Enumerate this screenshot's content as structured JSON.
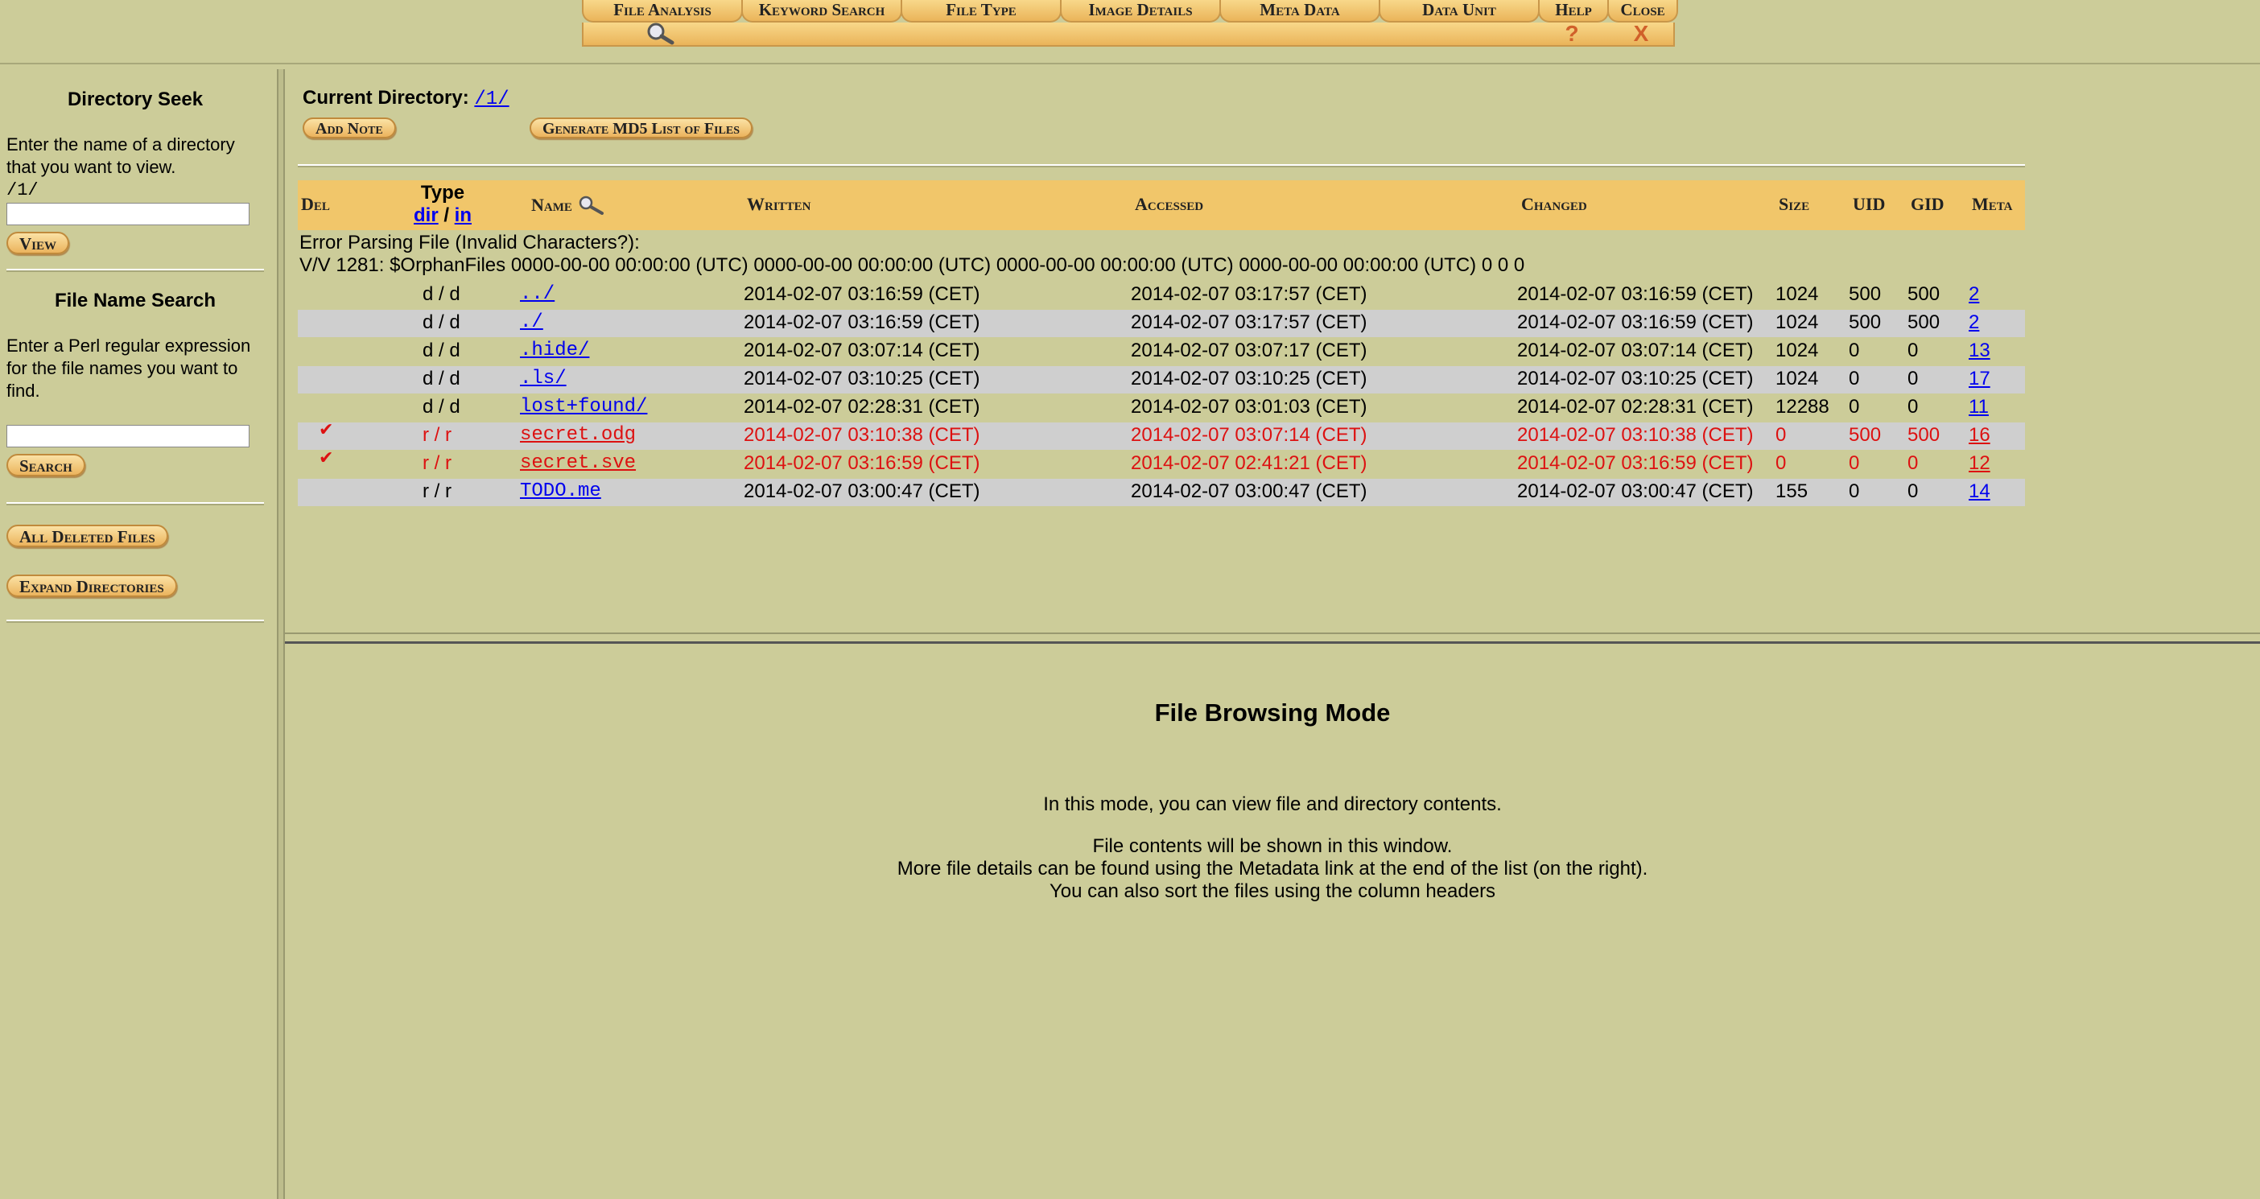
{
  "toolbar": {
    "tabs": [
      "File Analysis",
      "Keyword Search",
      "File Type",
      "Image Details",
      "Meta Data",
      "Data Unit",
      "Help",
      "Close"
    ],
    "help_glyph": "?",
    "close_glyph": "X"
  },
  "sidebar": {
    "dir_seek_title": "Directory Seek",
    "dir_seek_text": "Enter the name of a directory that you want to view.",
    "dir_seek_current": "/1/",
    "dir_input_value": "",
    "view_button": "View",
    "name_search_title": "File Name Search",
    "name_search_text": "Enter a Perl regular expression for the file names you want to find.",
    "name_input_value": "",
    "search_button": "Search",
    "all_deleted_button": "All Deleted Files",
    "expand_dirs_button": "Expand Directories"
  },
  "main": {
    "current_dir_label": "Current Directory:",
    "current_dir_path": "/1/",
    "add_note_button": "Add Note",
    "md5_button": "Generate MD5 List of Files",
    "columns": {
      "del": "Del",
      "type": "Type",
      "type_dir": "dir",
      "type_sep": "/",
      "type_in": "in",
      "name": "Name",
      "written": "Written",
      "accessed": "Accessed",
      "changed": "Changed",
      "size": "Size",
      "uid": "UID",
      "gid": "GID",
      "meta": "Meta"
    },
    "error_line1": "Error Parsing File (Invalid Characters?):",
    "error_line2": "V/V 1281: $OrphanFiles 0000-00-00 00:00:00 (UTC) 0000-00-00 00:00:00 (UTC) 0000-00-00 00:00:00 (UTC) 0000-00-00 00:00:00 (UTC) 0 0 0",
    "rows": [
      {
        "del": "",
        "type": "d / d",
        "name": "../",
        "written": "2014-02-07 03:16:59 (CET)",
        "accessed": "2014-02-07 03:17:57 (CET)",
        "changed": "2014-02-07 03:16:59 (CET)",
        "size": "1024",
        "uid": "500",
        "gid": "500",
        "meta": "2"
      },
      {
        "del": "",
        "type": "d / d",
        "name": "./",
        "written": "2014-02-07 03:16:59 (CET)",
        "accessed": "2014-02-07 03:17:57 (CET)",
        "changed": "2014-02-07 03:16:59 (CET)",
        "size": "1024",
        "uid": "500",
        "gid": "500",
        "meta": "2"
      },
      {
        "del": "",
        "type": "d / d",
        "name": ".hide/",
        "written": "2014-02-07 03:07:14 (CET)",
        "accessed": "2014-02-07 03:07:17 (CET)",
        "changed": "2014-02-07 03:07:14 (CET)",
        "size": "1024",
        "uid": "0",
        "gid": "0",
        "meta": "13"
      },
      {
        "del": "",
        "type": "d / d",
        "name": ".ls/",
        "written": "2014-02-07 03:10:25 (CET)",
        "accessed": "2014-02-07 03:10:25 (CET)",
        "changed": "2014-02-07 03:10:25 (CET)",
        "size": "1024",
        "uid": "0",
        "gid": "0",
        "meta": "17"
      },
      {
        "del": "",
        "type": "d / d",
        "name": "lost+found/",
        "written": "2014-02-07 02:28:31 (CET)",
        "accessed": "2014-02-07 03:01:03 (CET)",
        "changed": "2014-02-07 02:28:31 (CET)",
        "size": "12288",
        "uid": "0",
        "gid": "0",
        "meta": "11"
      },
      {
        "del": "✔",
        "type": "r / r",
        "name": "secret.odg",
        "written": "2014-02-07 03:10:38 (CET)",
        "accessed": "2014-02-07 03:07:14 (CET)",
        "changed": "2014-02-07 03:10:38 (CET)",
        "size": "0",
        "uid": "500",
        "gid": "500",
        "meta": "16"
      },
      {
        "del": "✔",
        "type": "r / r",
        "name": "secret.sve",
        "written": "2014-02-07 03:16:59 (CET)",
        "accessed": "2014-02-07 02:41:21 (CET)",
        "changed": "2014-02-07 03:16:59 (CET)",
        "size": "0",
        "uid": "0",
        "gid": "0",
        "meta": "12"
      },
      {
        "del": "",
        "type": "r / r",
        "name": "TODO.me",
        "written": "2014-02-07 03:00:47 (CET)",
        "accessed": "2014-02-07 03:00:47 (CET)",
        "changed": "2014-02-07 03:00:47 (CET)",
        "size": "155",
        "uid": "0",
        "gid": "0",
        "meta": "14"
      }
    ]
  },
  "info": {
    "title": "File Browsing Mode",
    "line1": "In this mode, you can view file and directory contents.",
    "line2": "File contents will be shown in this window.",
    "line3": "More file details can be found using the Metadata link at the end of the list (on the right).",
    "line4": "You can also sort the files using the column headers"
  },
  "colors": {
    "background": "#cccc99",
    "header_bar": "#f1c66a",
    "deleted_text": "#dd1111",
    "link": "#0000ee"
  }
}
